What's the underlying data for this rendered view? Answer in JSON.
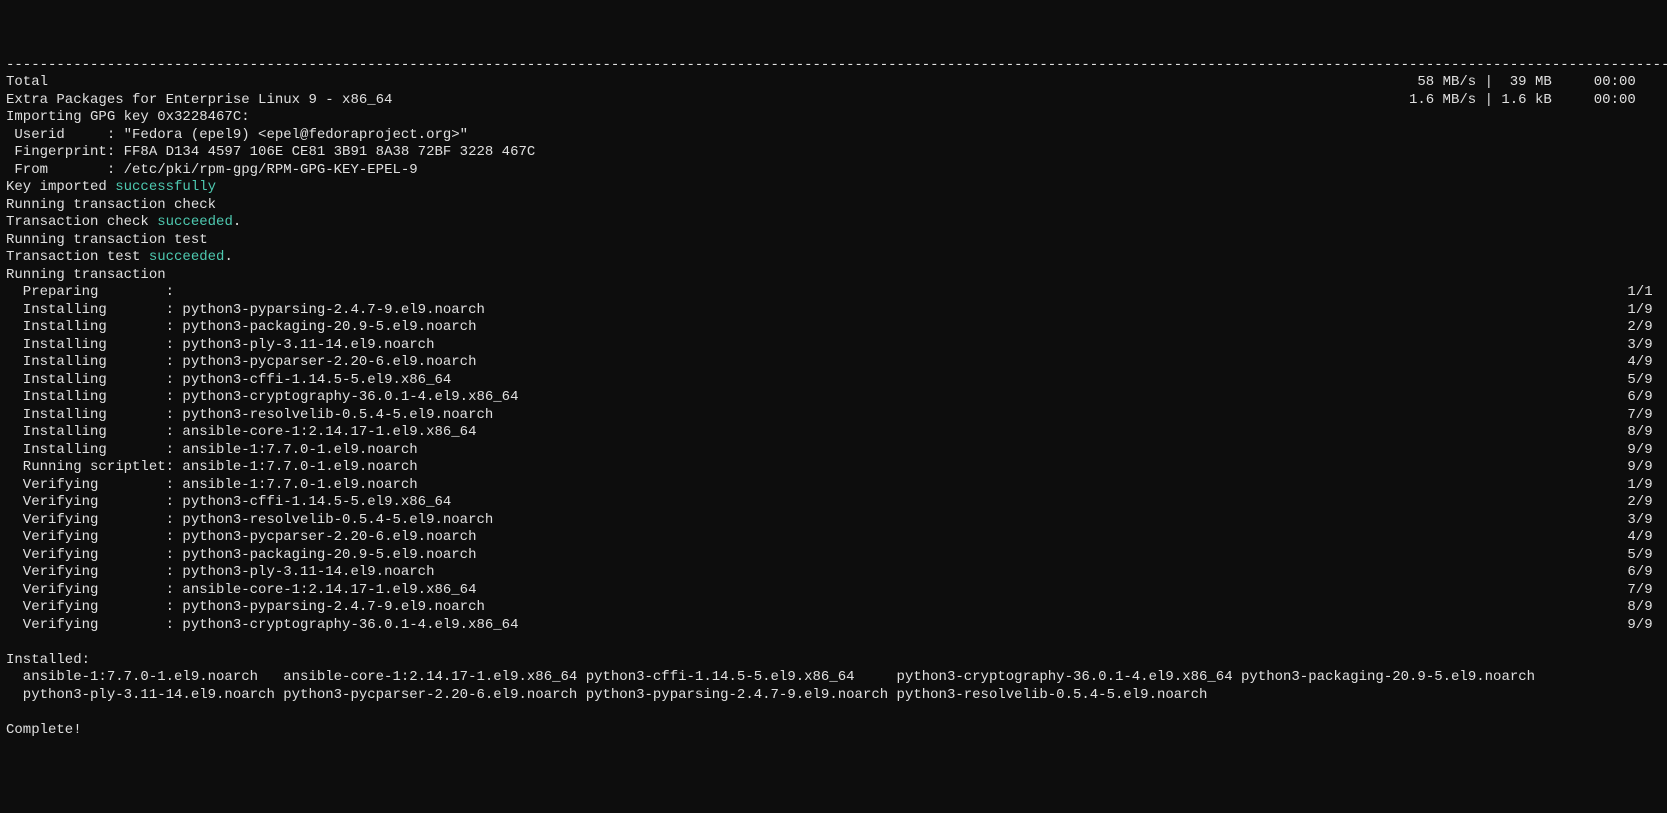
{
  "dashes": "----------------------------------------------------------------------------------------------------------------------------------------------------------------------------------------------------------------",
  "total": {
    "label": "Total",
    "stats": "58 MB/s |  39 MB     00:00   "
  },
  "epel": {
    "label": "Extra Packages for Enterprise Linux 9 - x86_64",
    "stats": "1.6 MB/s | 1.6 kB     00:00   "
  },
  "gpg": {
    "importing": "Importing GPG key 0x3228467C:",
    "userid_label": " Userid     :",
    "userid_value": " \"Fedora (epel9) <epel@fedoraproject.org>\"",
    "fingerprint_label": " Fingerprint:",
    "fingerprint_value": " FF8A D134 4597 106E CE81 3B91 8A38 72BF 3228 467C",
    "from_label": " From       :",
    "from_value": " /etc/pki/rpm-gpg/RPM-GPG-KEY-EPEL-9"
  },
  "key_imported_prefix": "Key imported ",
  "key_imported_status": "successfully",
  "tx_check": {
    "running": "Running transaction check",
    "result_prefix": "Transaction check ",
    "result_status": "succeeded",
    "result_suffix": "."
  },
  "tx_test": {
    "running": "Running transaction test",
    "result_prefix": "Transaction test ",
    "result_status": "succeeded",
    "result_suffix": "."
  },
  "running_tx": "Running transaction",
  "steps": [
    {
      "label": "  Preparing        :",
      "pkg": " ",
      "count": "1/1 "
    },
    {
      "label": "  Installing       :",
      "pkg": " python3-pyparsing-2.4.7-9.el9.noarch",
      "count": "1/9 "
    },
    {
      "label": "  Installing       :",
      "pkg": " python3-packaging-20.9-5.el9.noarch",
      "count": "2/9 "
    },
    {
      "label": "  Installing       :",
      "pkg": " python3-ply-3.11-14.el9.noarch",
      "count": "3/9 "
    },
    {
      "label": "  Installing       :",
      "pkg": " python3-pycparser-2.20-6.el9.noarch",
      "count": "4/9 "
    },
    {
      "label": "  Installing       :",
      "pkg": " python3-cffi-1.14.5-5.el9.x86_64",
      "count": "5/9 "
    },
    {
      "label": "  Installing       :",
      "pkg": " python3-cryptography-36.0.1-4.el9.x86_64",
      "count": "6/9 "
    },
    {
      "label": "  Installing       :",
      "pkg": " python3-resolvelib-0.5.4-5.el9.noarch",
      "count": "7/9 "
    },
    {
      "label": "  Installing       :",
      "pkg": " ansible-core-1:2.14.17-1.el9.x86_64",
      "count": "8/9 "
    },
    {
      "label": "  Installing       :",
      "pkg": " ansible-1:7.7.0-1.el9.noarch",
      "count": "9/9 "
    },
    {
      "label": "  Running scriptlet:",
      "pkg": " ansible-1:7.7.0-1.el9.noarch",
      "count": "9/9 "
    },
    {
      "label": "  Verifying        :",
      "pkg": " ansible-1:7.7.0-1.el9.noarch",
      "count": "1/9 "
    },
    {
      "label": "  Verifying        :",
      "pkg": " python3-cffi-1.14.5-5.el9.x86_64",
      "count": "2/9 "
    },
    {
      "label": "  Verifying        :",
      "pkg": " python3-resolvelib-0.5.4-5.el9.noarch",
      "count": "3/9 "
    },
    {
      "label": "  Verifying        :",
      "pkg": " python3-pycparser-2.20-6.el9.noarch",
      "count": "4/9 "
    },
    {
      "label": "  Verifying        :",
      "pkg": " python3-packaging-20.9-5.el9.noarch",
      "count": "5/9 "
    },
    {
      "label": "  Verifying        :",
      "pkg": " python3-ply-3.11-14.el9.noarch",
      "count": "6/9 "
    },
    {
      "label": "  Verifying        :",
      "pkg": " ansible-core-1:2.14.17-1.el9.x86_64",
      "count": "7/9 "
    },
    {
      "label": "  Verifying        :",
      "pkg": " python3-pyparsing-2.4.7-9.el9.noarch",
      "count": "8/9 "
    },
    {
      "label": "  Verifying        :",
      "pkg": " python3-cryptography-36.0.1-4.el9.x86_64",
      "count": "9/9 "
    }
  ],
  "installed": {
    "header": "Installed:",
    "line1": "  ansible-1:7.7.0-1.el9.noarch   ansible-core-1:2.14.17-1.el9.x86_64 python3-cffi-1.14.5-5.el9.x86_64     python3-cryptography-36.0.1-4.el9.x86_64 python3-packaging-20.9-5.el9.noarch",
    "line2": "  python3-ply-3.11-14.el9.noarch python3-pycparser-2.20-6.el9.noarch python3-pyparsing-2.4.7-9.el9.noarch python3-resolvelib-0.5.4-5.el9.noarch"
  },
  "complete": "Complete!"
}
